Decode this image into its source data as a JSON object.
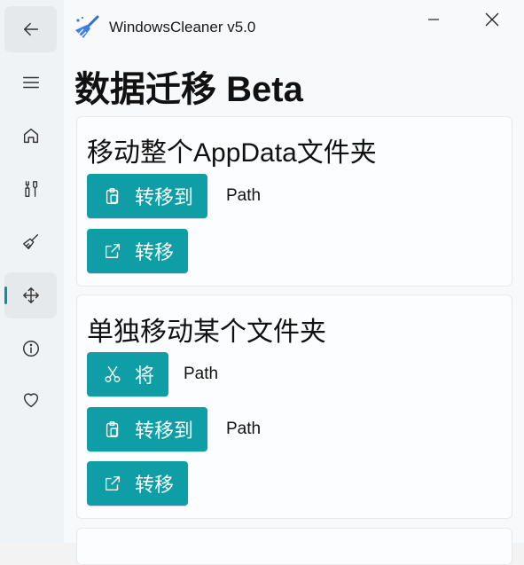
{
  "window": {
    "app_title": "WindowsCleaner v5.0",
    "accent": "#0f9ea6"
  },
  "nav": {
    "items": [
      {
        "icon": "back-arrow-icon"
      },
      {
        "icon": "hamburger-menu-icon"
      },
      {
        "icon": "home-icon"
      },
      {
        "icon": "tools-icon"
      },
      {
        "icon": "broom-icon"
      },
      {
        "icon": "move-arrows-icon",
        "selected": true
      },
      {
        "icon": "info-icon"
      },
      {
        "icon": "heart-icon"
      }
    ]
  },
  "page": {
    "title": "数据迁移 Beta"
  },
  "card_appdata": {
    "title": "移动整个AppData文件夹",
    "move_to_label": "转移到",
    "move_to_path": "Path",
    "migrate_label": "转移"
  },
  "card_folder": {
    "title": "单独移动某个文件夹",
    "source_label": "将",
    "source_path": "Path",
    "move_to_label": "转移到",
    "move_to_path": "Path",
    "migrate_label": "转移"
  }
}
